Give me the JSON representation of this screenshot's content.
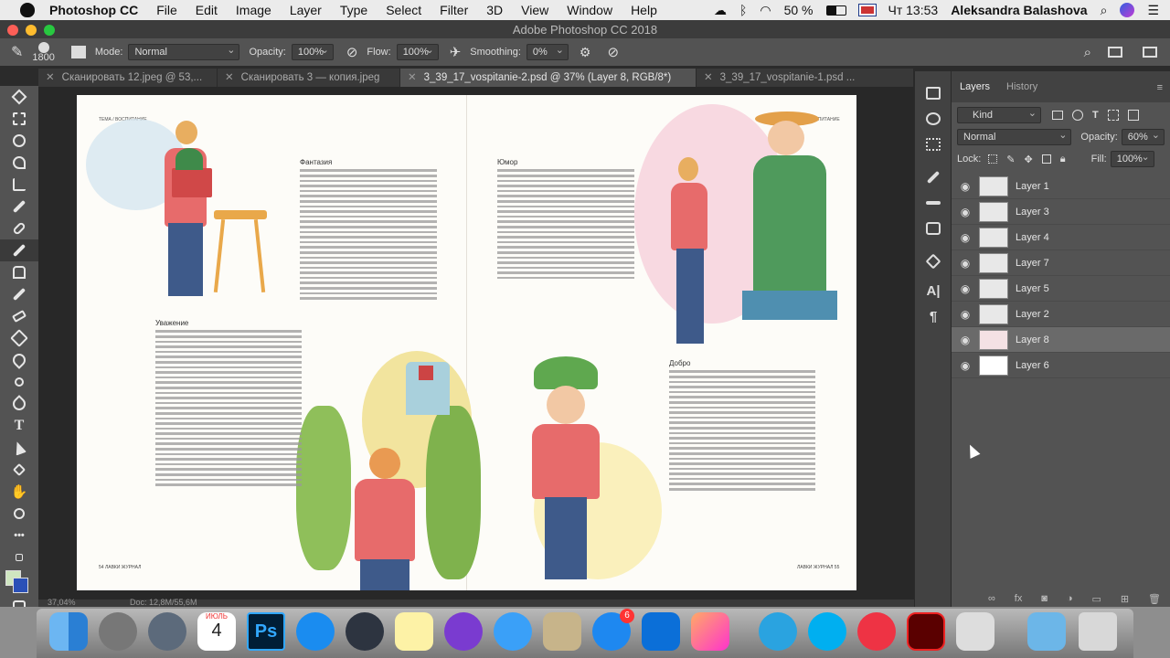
{
  "menubar": {
    "app": "Photoshop CC",
    "items": [
      "File",
      "Edit",
      "Image",
      "Layer",
      "Type",
      "Select",
      "Filter",
      "3D",
      "View",
      "Window",
      "Help"
    ],
    "battery": "50 %",
    "clock": "Чт 13:53",
    "user": "Aleksandra Balashova"
  },
  "window": {
    "title": "Adobe Photoshop CC 2018"
  },
  "options": {
    "brush_size": "1800",
    "mode_label": "Mode:",
    "mode_value": "Normal",
    "opacity_label": "Opacity:",
    "opacity_value": "100%",
    "flow_label": "Flow:",
    "flow_value": "100%",
    "smoothing_label": "Smoothing:",
    "smoothing_value": "0%"
  },
  "tabs": [
    {
      "label": "Сканировать 12.jpeg @ 53,..."
    },
    {
      "label": "Сканировать 3 — копия.jpeg"
    },
    {
      "label": "3_39_17_vospitanie-2.psd @ 37% (Layer 8, RGB/8*)"
    },
    {
      "label": "3_39_17_vospitanie-1.psd ..."
    }
  ],
  "document": {
    "left_header": "ТЕМА / ВОСПИТАНИЕ",
    "right_header": "ТЕМА / ВОСПИТАНИЕ",
    "sections": {
      "respect": "Уважение",
      "fantasy": "Фантазия",
      "humor": "Юмор",
      "kindness": "Добро"
    },
    "footer_left": "54 ЛАВКИ ЖУРНАЛ",
    "footer_right": "ЛАВКИ ЖУРНАЛ 55"
  },
  "status": {
    "zoom": "37,04%",
    "doc": "Doc: 12,8M/55,6M"
  },
  "layers_panel": {
    "tab_layers": "Layers",
    "tab_history": "History",
    "kind_label": "Kind",
    "blend_mode": "Normal",
    "opacity_label": "Opacity:",
    "opacity_value": "60%",
    "lock_label": "Lock:",
    "fill_label": "Fill:",
    "fill_value": "100%",
    "layers": [
      {
        "name": "Layer 1"
      },
      {
        "name": "Layer 3"
      },
      {
        "name": "Layer 4"
      },
      {
        "name": "Layer 7"
      },
      {
        "name": "Layer 5"
      },
      {
        "name": "Layer 2"
      },
      {
        "name": "Layer 8",
        "selected": true
      },
      {
        "name": "Layer 6"
      }
    ]
  },
  "dock": {
    "calendar_month": "ИЮЛЬ",
    "calendar_day": "4",
    "appstore_badge": "6",
    "photoshop_label": "Ps"
  },
  "colors": {
    "ps_blue": "#31a8ff",
    "accent": "#2c6ecb"
  }
}
